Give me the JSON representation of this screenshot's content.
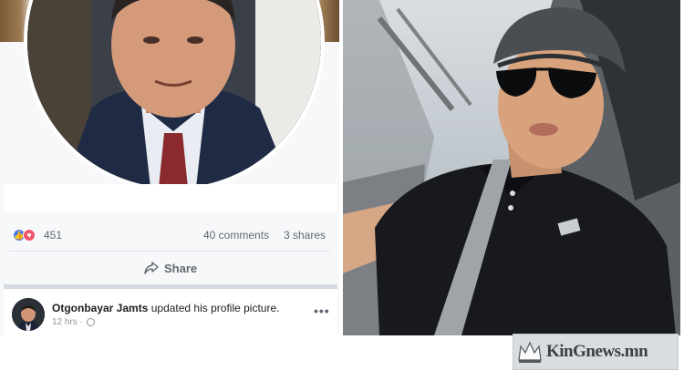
{
  "post": {
    "reaction_count": "451",
    "comments": "40 comments",
    "shares": "3 shares",
    "share_label": "Share",
    "author": "Otgonbayar Jamts",
    "action": "updated his profile picture.",
    "time": "12 hrs ·",
    "more": "•••"
  },
  "icons": {
    "like": "like-reaction",
    "love": "love-reaction",
    "share": "share-arrow",
    "globe": "globe",
    "more": "more-options",
    "crown": "crown"
  },
  "watermark": {
    "text": "KinGnews.mn"
  }
}
